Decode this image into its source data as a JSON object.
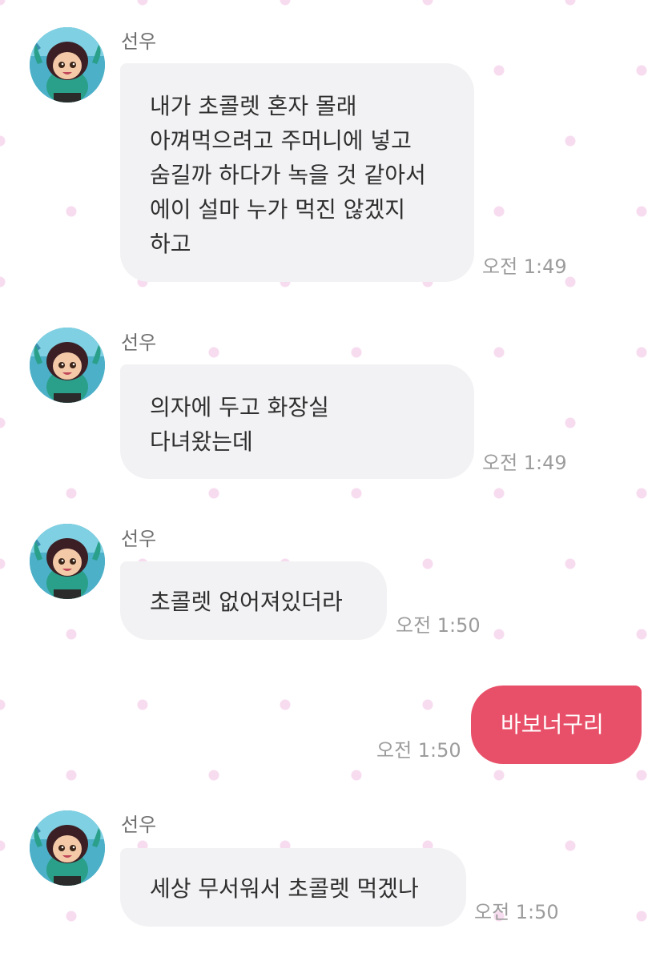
{
  "chat": {
    "sender_name": "선우",
    "messages": [
      {
        "sender": "선우",
        "text": "내가 초콜렛 혼자 몰래\n아껴먹으려고 주머니에 넣고\n숨길까 하다가 녹을 것 같아서\n에이 설마 누가 먹진 않겠지\n하고",
        "time": "오전 1:49"
      },
      {
        "sender": "선우",
        "text": "의자에 두고 화장실\n다녀왔는데",
        "time": "오전 1:49"
      },
      {
        "sender": "선우",
        "text": "초콜렛 없어져있더라",
        "time": "오전 1:50"
      },
      {
        "sender": "me",
        "text": "바보너구리",
        "time": "오전 1:50"
      },
      {
        "sender": "선우",
        "text": "세상 무서워서 초콜렛 먹겠나",
        "time": "오전 1:50"
      }
    ]
  },
  "colors": {
    "incoming_bubble": "#f2f2f4",
    "outgoing_bubble": "#e85069",
    "background_dot": "#f7dcef",
    "timestamp": "#9c9c9c"
  },
  "icons": {
    "avatar": "profile-avatar-girl-cartoon"
  }
}
